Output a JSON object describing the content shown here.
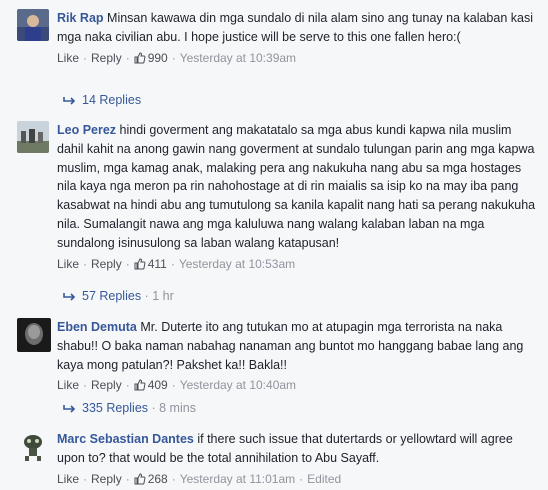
{
  "comments": [
    {
      "author": "Rik Rap",
      "text": "Minsan kawawa din mga sundalo di nila alam sino ang tunay na kalaban kasi mga naka civilian abu. I hope justice will be serve to this one fallen hero:(",
      "like_label": "Like",
      "reply_label": "Reply",
      "likes": "990",
      "time": "Yesterday at 10:39am",
      "edited": "",
      "replies_label": "14 Replies",
      "replies_age": ""
    },
    {
      "author": "Leo Perez",
      "text": "hindi goverment ang makatatalo sa mga abus kundi kapwa nila muslim dahil kahit na anong gawin nang goverment at sundalo tulungan parin ang mga kapwa muslim, mga kamag anak, malaking pera ang nakukuha nang abu sa mga hostages nila kaya nga meron pa rin nahohostage at di rin maialis sa isip ko na may iba pang kasabwat na hindi abu ang tumutulong sa kanila kapalit nang hati sa perang nakukuha nila. Sumalangit nawa ang mga kaluluwa nang walang kalaban laban na mga sundalong isinusulong sa laban walang katapusan!",
      "like_label": "Like",
      "reply_label": "Reply",
      "likes": "411",
      "time": "Yesterday at 10:53am",
      "edited": "",
      "replies_label": "57 Replies",
      "replies_age": "1 hr"
    },
    {
      "author": "Eben Demuta",
      "text": "Mr. Duterte ito ang tutukan mo at atupagin mga terrorista na naka shabu!! O baka naman nabahag nanaman ang buntot mo hanggang babae lang ang kaya mong patulan?! Pakshet ka!! Bakla!!",
      "like_label": "Like",
      "reply_label": "Reply",
      "likes": "409",
      "time": "Yesterday at 10:40am",
      "edited": "",
      "replies_label": "335 Replies",
      "replies_age": "8 mins"
    },
    {
      "author": "Marc Sebastian Dantes",
      "text": "if there such issue that dutertards or yellowtard will agree upon to? that would be the total annihilation to Abu Sayaff.",
      "like_label": "Like",
      "reply_label": "Reply",
      "likes": "268",
      "time": "Yesterday at 11:01am",
      "edited": "Edited",
      "replies_label": "",
      "replies_age": ""
    }
  ],
  "colors": {
    "author": "#365899",
    "meta": "#90949c",
    "text": "#1d2129",
    "background": "#f6f7f9"
  },
  "icons": {
    "like": "thumbs-up-icon",
    "reply_arrow": "reply-arrow-icon"
  }
}
